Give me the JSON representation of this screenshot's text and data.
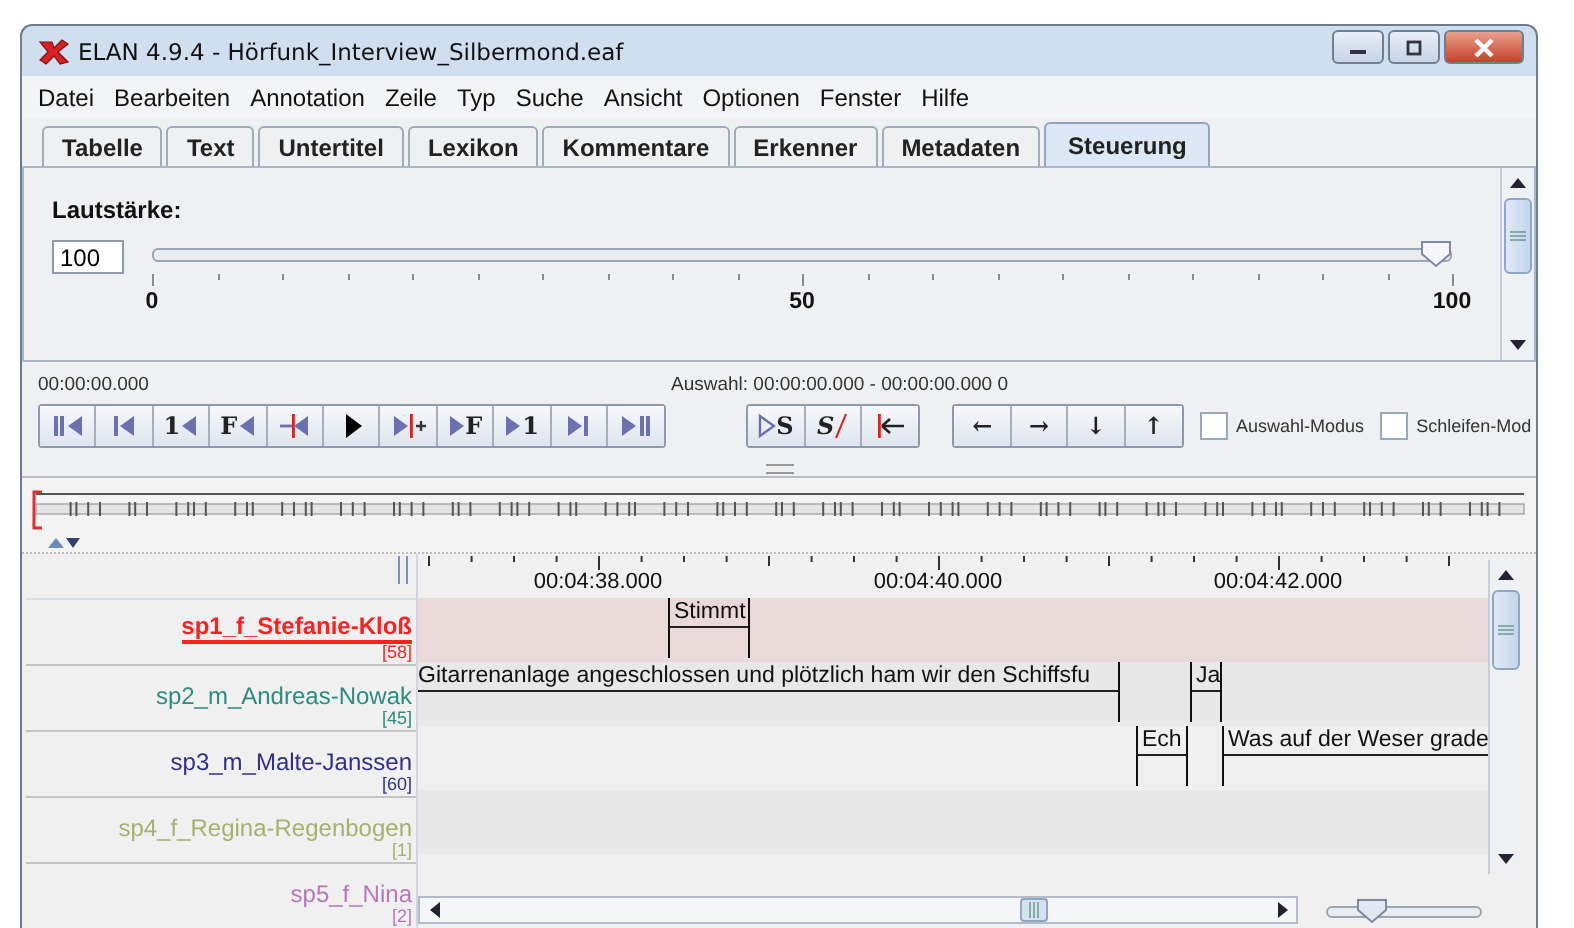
{
  "window": {
    "title": "ELAN 4.9.4 - Hörfunk_Interview_Silbermond.eaf"
  },
  "menu": [
    "Datei",
    "Bearbeiten",
    "Annotation",
    "Zeile",
    "Typ",
    "Suche",
    "Ansicht",
    "Optionen",
    "Fenster",
    "Hilfe"
  ],
  "tabs": [
    {
      "label": "Tabelle",
      "selected": false
    },
    {
      "label": "Text",
      "selected": false
    },
    {
      "label": "Untertitel",
      "selected": false
    },
    {
      "label": "Lexikon",
      "selected": false
    },
    {
      "label": "Kommentare",
      "selected": false
    },
    {
      "label": "Erkenner",
      "selected": false
    },
    {
      "label": "Metadaten",
      "selected": false
    },
    {
      "label": "Steuerung",
      "selected": true
    }
  ],
  "volume": {
    "label": "Lautstärke:",
    "value": "100",
    "level": 1.0,
    "scale": [
      "0",
      "50",
      "100"
    ]
  },
  "controls": {
    "time": "00:00:00.000",
    "selection": "Auswahl: 00:00:00.000 - 00:00:00.000  0",
    "player_buttons": [
      {
        "kind": "begin"
      },
      {
        "kind": "prev-second"
      },
      {
        "kind": "step-back",
        "label": "1"
      },
      {
        "kind": "step-back",
        "label": "F"
      },
      {
        "kind": "selection-back"
      },
      {
        "kind": "play"
      },
      {
        "kind": "selection-forward"
      },
      {
        "kind": "step-forward",
        "label": "F"
      },
      {
        "kind": "step-forward",
        "label": "1"
      },
      {
        "kind": "next-second"
      },
      {
        "kind": "end"
      }
    ],
    "selection_buttons": [
      {
        "kind": "play-selection",
        "label": "S"
      },
      {
        "kind": "clear-selection",
        "label": "S"
      },
      {
        "kind": "to-selection-begin"
      }
    ],
    "navigation_buttons": [
      {
        "label": "←"
      },
      {
        "label": "→"
      },
      {
        "label": "↓"
      },
      {
        "label": "↑"
      }
    ],
    "checkboxes": [
      {
        "label": "Auswahl-Modus",
        "checked": false
      },
      {
        "label": "Schleifen-Mod",
        "checked": false
      }
    ]
  },
  "timeline": {
    "ruler": [
      "00:04:38.000",
      "00:04:40.000",
      "00:04:42.000"
    ],
    "tiers": [
      {
        "name": "sp1_f_Stefanie-Kloß",
        "count": "[58]",
        "color": "#ff2020",
        "selected": true,
        "annotations": [
          {
            "text": "Stimmt"
          }
        ]
      },
      {
        "name": "sp2_m_Andreas-Nowak",
        "count": "[45]",
        "color": "#2e8b80",
        "selected": false,
        "annotations": [
          {
            "text": "Gitarrenanlage angeschlossen und plötzlich ham wir den Schiffsfu"
          },
          {
            "text": "Ja"
          }
        ]
      },
      {
        "name": "sp3_m_Malte-Janssen",
        "count": "[60]",
        "color": "#303088",
        "selected": false,
        "annotations": [
          {
            "text": "Ech"
          },
          {
            "text": "Was auf der Weser grade"
          }
        ]
      },
      {
        "name": "sp4_f_Regina-Regenbogen",
        "count": "[1]",
        "color": "#a8b070",
        "selected": false
      },
      {
        "name": "sp5_f_Nina",
        "count": "[2]",
        "color": "#b878b8",
        "selected": false
      }
    ],
    "zoom": {
      "level": 0.3
    }
  }
}
